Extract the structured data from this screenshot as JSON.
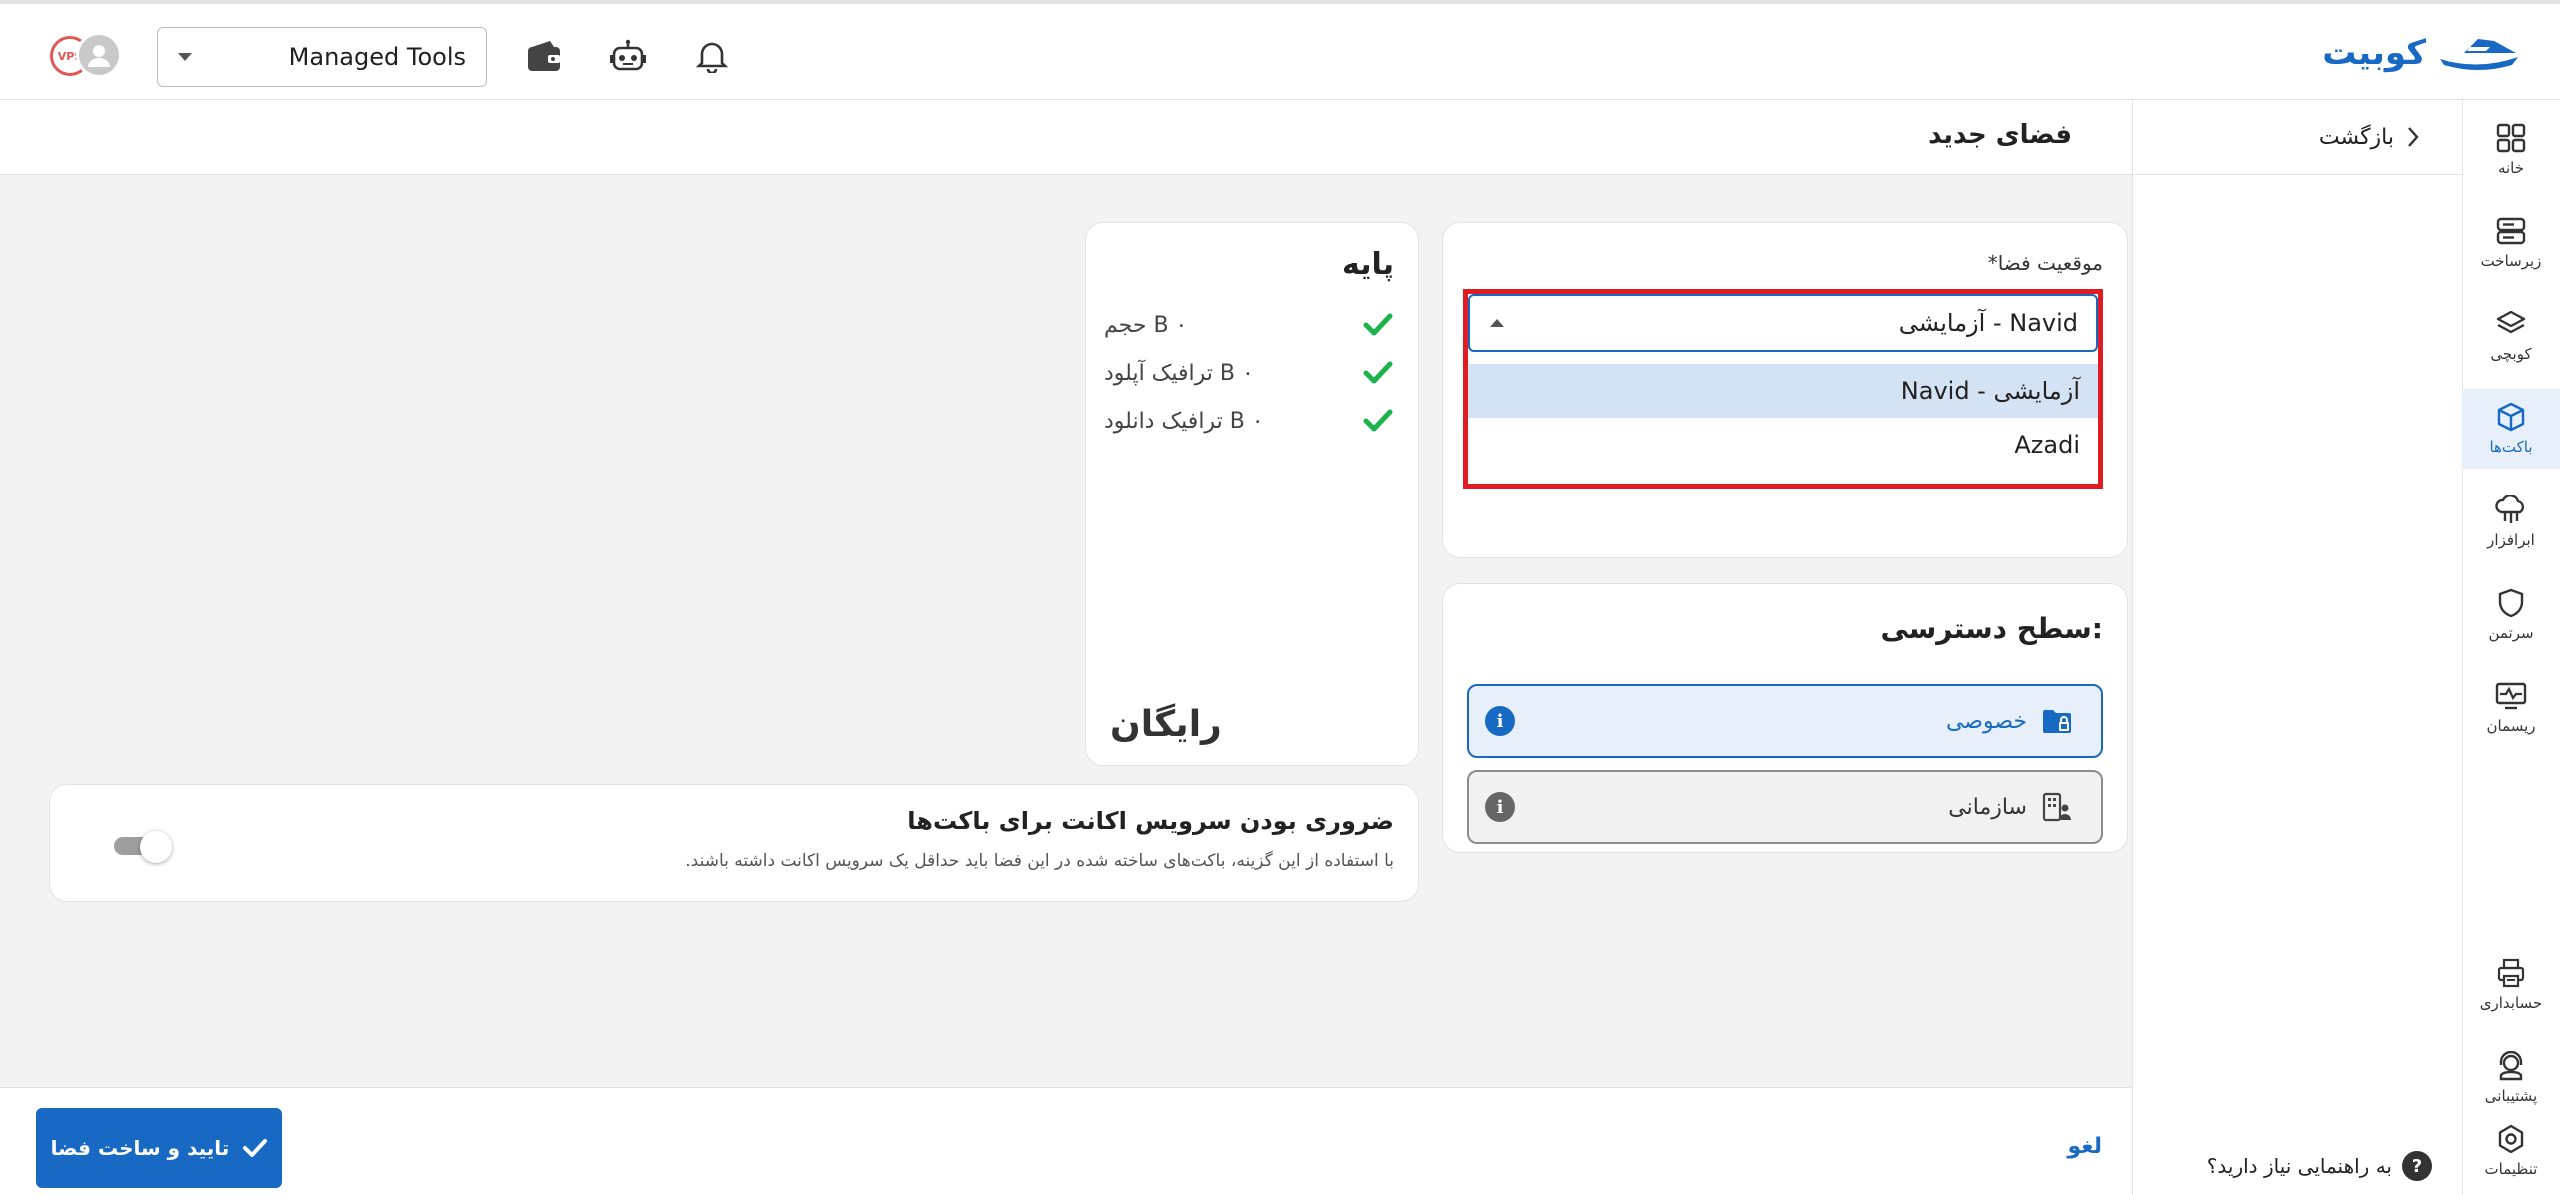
{
  "header": {
    "logo_text": "کوبیت",
    "tools_selector": "Managed Tools",
    "avatar_badge": "VPS"
  },
  "sidebar": {
    "items": [
      {
        "label": "خانه",
        "icon": "grid-icon"
      },
      {
        "label": "زیرساخت",
        "icon": "server-icon"
      },
      {
        "label": "کوبچی",
        "icon": "layers-icon"
      },
      {
        "label": "باکت‌ها",
        "icon": "cube-icon"
      },
      {
        "label": "ابرافزار",
        "icon": "cloud-icon"
      },
      {
        "label": "سرتمن",
        "icon": "shield-icon"
      },
      {
        "label": "ریسمان",
        "icon": "monitor-pulse-icon"
      },
      {
        "label": "حسابداری",
        "icon": "printer-icon"
      },
      {
        "label": "پشتیبانی",
        "icon": "headset-icon"
      },
      {
        "label": "تنظیمات",
        "icon": "gear-icon"
      }
    ],
    "active_index": 3
  },
  "subpanel": {
    "back_label": "بازگشت",
    "help_label": "به راهنمایی نیاز دارید؟",
    "help_glyph": "?"
  },
  "page": {
    "title": "فضای جدید"
  },
  "location": {
    "label": "موقعیت فضا*",
    "selected": "Navid - آزمایشی",
    "options": [
      "Navid - آزمایشی",
      "Azadi"
    ]
  },
  "access": {
    "title": "سطح دسترسی:",
    "private_label": "خصوصی",
    "org_label": "سازمانی",
    "info_glyph": "i"
  },
  "plan": {
    "title": "پایه",
    "features": [
      "B ۰ حجم",
      "B ۰ ترافیک آپلود",
      "B ۰ ترافیک دانلود"
    ],
    "price": "رایگان"
  },
  "requirement": {
    "title": "ضروری بودن سرویس اکانت برای باکت‌ها",
    "description": "با استفاده از این گزینه، باکت‌های ساخته شده در این فضا باید حداقل یک سرویس اکانت داشته باشند.",
    "enabled": false
  },
  "footer": {
    "confirm_label": "تایید و ساخت فضا",
    "cancel_label": "لغو"
  },
  "colors": {
    "primary": "#1769c4",
    "highlight_border": "#e11b22",
    "check": "#1cb34a",
    "info_private": "#1769c4",
    "info_org": "#666666"
  }
}
